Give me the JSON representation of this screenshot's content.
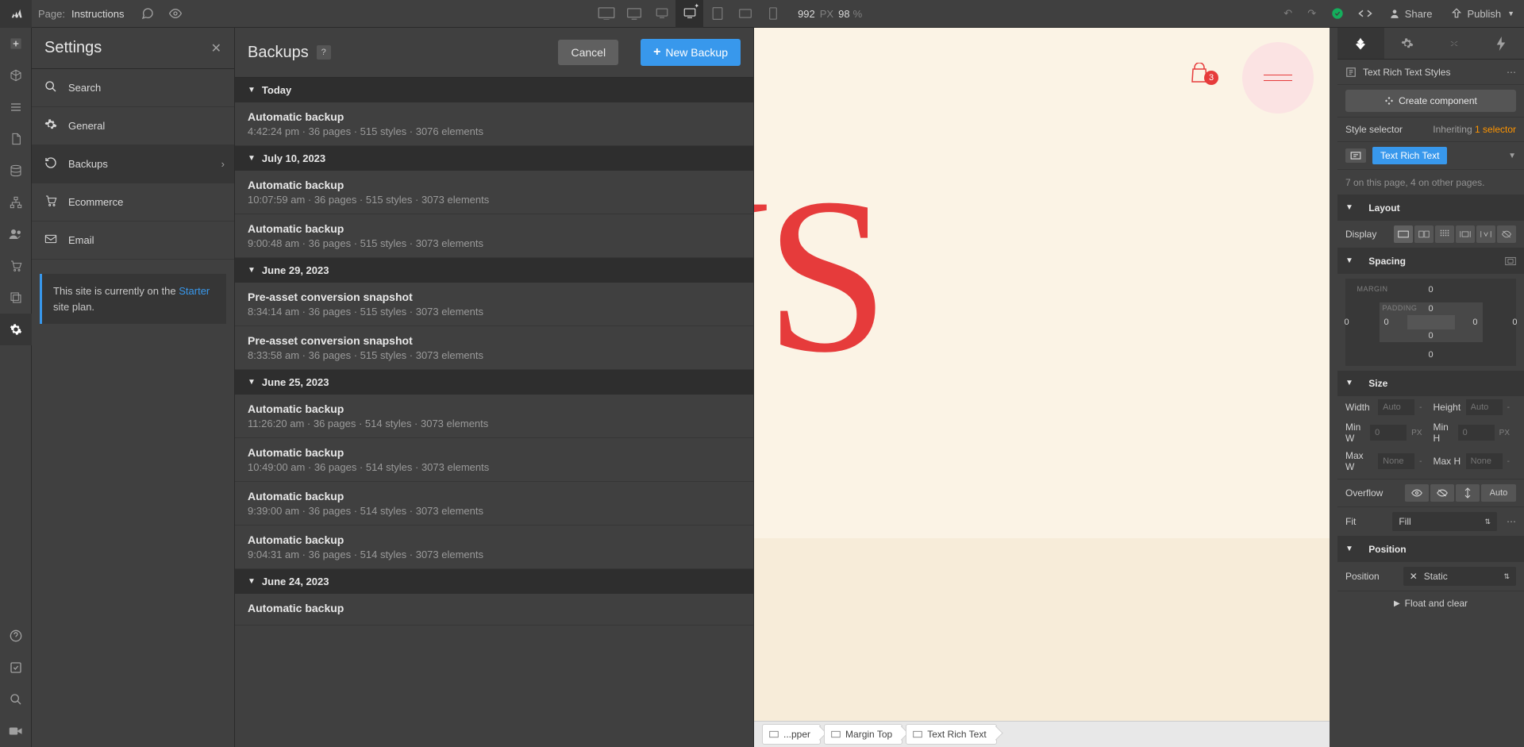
{
  "topbar": {
    "page_prefix": "Page:",
    "page_name": "Instructions",
    "width": "992",
    "px_label": "PX",
    "zoom": "98",
    "pct_label": "%",
    "share": "Share",
    "publish": "Publish"
  },
  "settings": {
    "title": "Settings",
    "items": [
      {
        "label": "Search",
        "icon": "search"
      },
      {
        "label": "General",
        "icon": "gear"
      },
      {
        "label": "Backups",
        "icon": "restore",
        "active": true
      },
      {
        "label": "Ecommerce",
        "icon": "cart"
      },
      {
        "label": "Email",
        "icon": "mail"
      }
    ],
    "plan_notice_pre": "This site is currently on the ",
    "plan_link": "Starter",
    "plan_notice_post": " site plan."
  },
  "backups": {
    "title": "Backups",
    "cancel": "Cancel",
    "new": "New Backup",
    "groups": [
      {
        "date": "Today",
        "items": [
          {
            "title": "Automatic backup",
            "meta": "4:42:24 pm · 36 pages · 515 styles · 3076 elements"
          }
        ]
      },
      {
        "date": "July 10, 2023",
        "items": [
          {
            "title": "Automatic backup",
            "meta": "10:07:59 am · 36 pages · 515 styles · 3073 elements"
          },
          {
            "title": "Automatic backup",
            "meta": "9:00:48 am · 36 pages · 515 styles · 3073 elements"
          }
        ]
      },
      {
        "date": "June 29, 2023",
        "items": [
          {
            "title": "Pre-asset conversion snapshot",
            "meta": "8:34:14 am · 36 pages · 515 styles · 3073 elements"
          },
          {
            "title": "Pre-asset conversion snapshot",
            "meta": "8:33:58 am · 36 pages · 515 styles · 3073 elements"
          }
        ]
      },
      {
        "date": "June 25, 2023",
        "items": [
          {
            "title": "Automatic backup",
            "meta": "11:26:20 am · 36 pages · 514 styles · 3073 elements"
          },
          {
            "title": "Automatic backup",
            "meta": "10:49:00 am · 36 pages · 514 styles · 3073 elements"
          },
          {
            "title": "Automatic backup",
            "meta": "9:39:00 am · 36 pages · 514 styles · 3073 elements"
          },
          {
            "title": "Automatic backup",
            "meta": "9:04:31 am · 36 pages · 514 styles · 3073 elements"
          }
        ]
      },
      {
        "date": "June 24, 2023",
        "items": [
          {
            "title": "Automatic backup",
            "meta": ""
          }
        ]
      }
    ]
  },
  "canvas": {
    "cart_count": "3",
    "big_text": "NS",
    "breadcrumbs": [
      {
        "label": "...pper"
      },
      {
        "label": "Margin Top"
      },
      {
        "label": "Text Rich Text"
      }
    ]
  },
  "style": {
    "element_name": "Text Rich Text Styles",
    "create_component": "Create component",
    "selector_label": "Style selector",
    "inheriting_pre": "Inheriting ",
    "inheriting_count": "1 selector",
    "tag": "Text Rich Text",
    "selector_stats": "7 on this page, 4 on other pages.",
    "layout": "Layout",
    "display": "Display",
    "spacing": "Spacing",
    "margin": "MARGIN",
    "padding": "PADDING",
    "size": "Size",
    "width": "Width",
    "height": "Height",
    "minw": "Min W",
    "minh": "Min H",
    "maxw": "Max W",
    "maxh": "Max H",
    "auto": "Auto",
    "none": "None",
    "zero": "0",
    "px": "PX",
    "dash": "-",
    "overflow": "Overflow",
    "fit": "Fit",
    "fit_val": "Fill",
    "position": "Position",
    "pos_val": "Static",
    "float": "Float and clear",
    "spacing_vals": {
      "mt": "0",
      "mr": "0",
      "mb": "0",
      "ml": "0",
      "pt": "0",
      "pr": "0",
      "pb": "0",
      "pl": "0"
    }
  }
}
